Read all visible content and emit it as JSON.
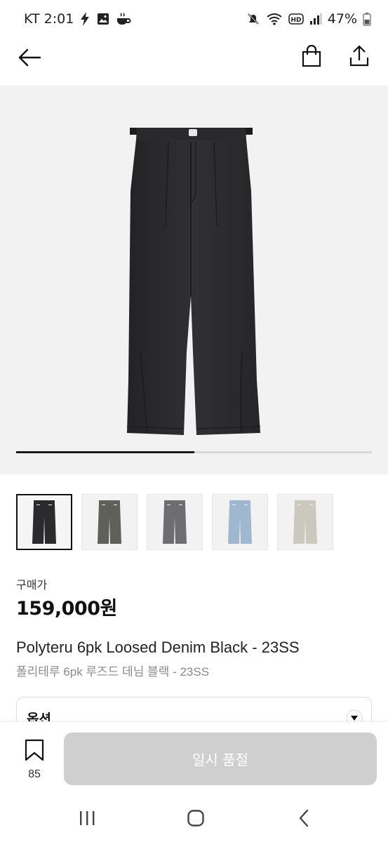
{
  "status_bar": {
    "carrier_time": "KT 2:01",
    "battery": "47%",
    "icons": [
      "flash-icon",
      "gallery-icon",
      "coffee-icon",
      "mute-icon",
      "wifi-icon",
      "hd-icon",
      "signal-icon",
      "battery-icon"
    ]
  },
  "header": {
    "icons": [
      "back-arrow-icon",
      "shopping-bag-icon",
      "share-icon"
    ]
  },
  "gallery": {
    "progress": 0.5,
    "thumbnails": [
      {
        "name": "black",
        "color": "#2b2b2d",
        "selected": true
      },
      {
        "name": "olive",
        "color": "#5f605a",
        "selected": false
      },
      {
        "name": "grey",
        "color": "#6e6e70",
        "selected": false
      },
      {
        "name": "light-blue",
        "color": "#9fb7cf",
        "selected": false
      },
      {
        "name": "ivory",
        "color": "#cbc8bd",
        "selected": false
      }
    ]
  },
  "price": {
    "label": "구매가",
    "value": "159,000원"
  },
  "product": {
    "name_en": "Polyteru 6pk Loosed Denim Black - 23SS",
    "name_ko": "폴리테루 6pk 루즈드 데님 블랙 - 23SS"
  },
  "option": {
    "label": "옵션"
  },
  "action_bar": {
    "wish_count": "85",
    "soldout_label": "일시 품절"
  },
  "system_nav": {
    "icons": [
      "recent-apps-icon",
      "home-icon",
      "back-icon"
    ]
  },
  "colors": {
    "accent": "#111111",
    "disabled_button": "#cfcfcf",
    "hero_bg": "#f2f2f2"
  }
}
